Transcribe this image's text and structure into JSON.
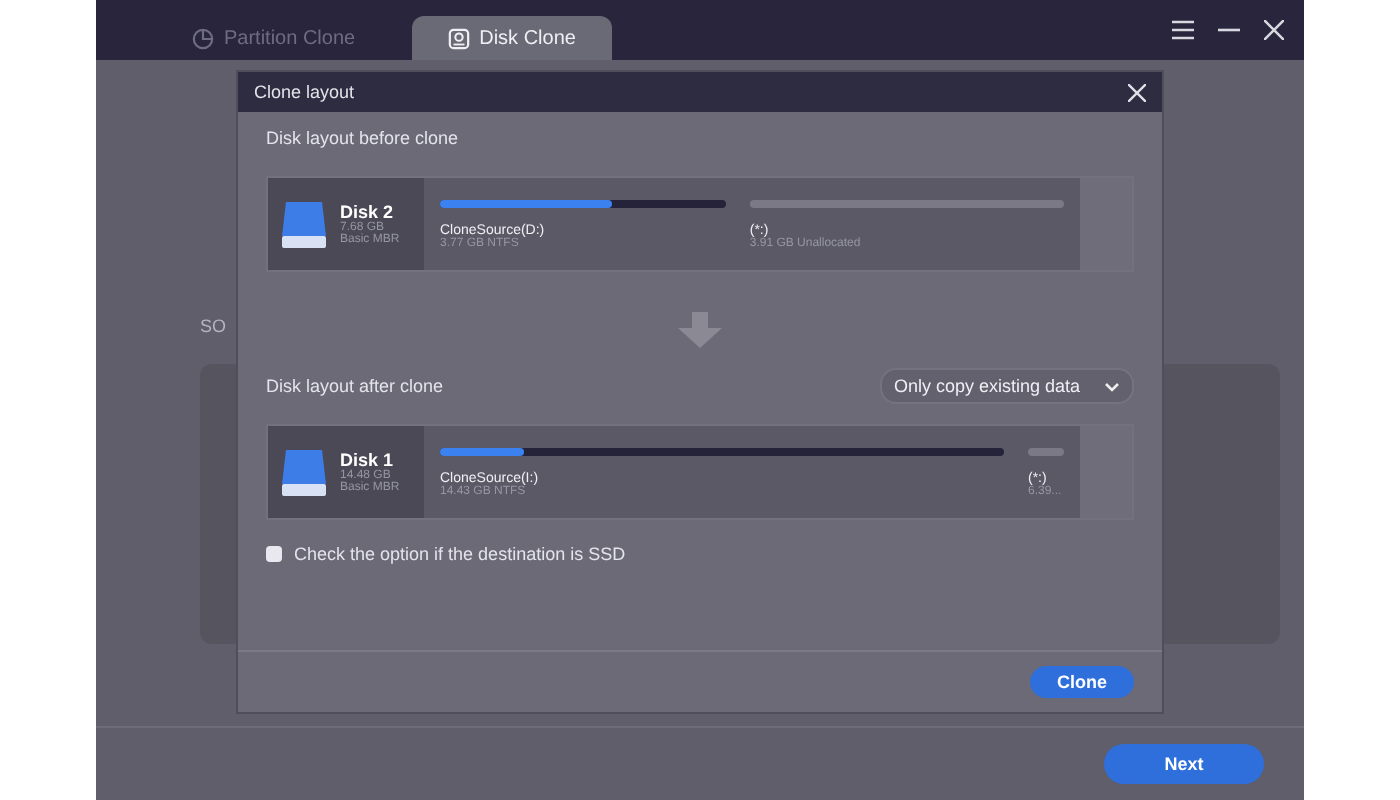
{
  "tabs": [
    {
      "label": "Partition Clone",
      "selected": false
    },
    {
      "label": "Disk Clone",
      "selected": true
    }
  ],
  "background": {
    "section_label": "SO",
    "next_button": "Next"
  },
  "dialog": {
    "title": "Clone layout",
    "before": {
      "heading": "Disk layout before clone",
      "disk": {
        "name": "Disk 2",
        "size": "7.68 GB",
        "type": "Basic MBR"
      },
      "partitions": [
        {
          "kind": "used",
          "name": "CloneSource(D:)",
          "detail": "3.77 GB NTFS",
          "level": 0.6
        },
        {
          "kind": "free",
          "name": "(*:)",
          "detail": "3.91 GB Unallocated"
        }
      ]
    },
    "after": {
      "heading": "Disk layout after clone",
      "mode": "Only copy existing data",
      "disk": {
        "name": "Disk 1",
        "size": "14.48 GB",
        "type": "Basic MBR"
      },
      "partitions": [
        {
          "kind": "used",
          "name": "CloneSource(I:)",
          "detail": "14.43 GB NTFS",
          "level": 0.15
        },
        {
          "kind": "small",
          "name": "(*:)",
          "detail": "6.39..."
        }
      ]
    },
    "ssd_option": {
      "label": "Check the option if the destination is SSD",
      "checked": false
    },
    "clone_button": "Clone"
  }
}
